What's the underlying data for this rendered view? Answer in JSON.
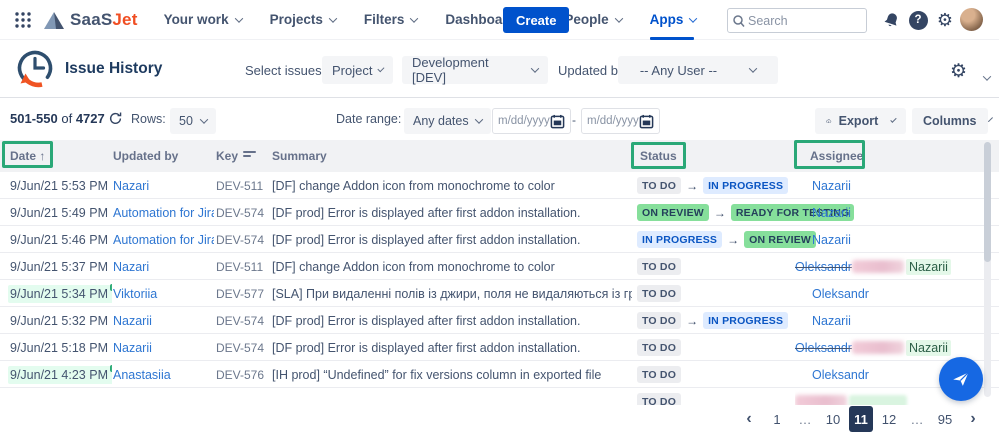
{
  "colors": {
    "brand_blue": "#0052CC",
    "logo_orange": "#F04E23",
    "annotation_green": "#2AA877",
    "badge_green_bg": "#86DF9B",
    "badge_blue_bg": "#DEEBFF",
    "selected_page_bg": "#253858",
    "fab_blue": "#1668E3"
  },
  "nav": {
    "logo_saas": "SaaS",
    "logo_jet": "Jet",
    "items": [
      {
        "label": "Your work",
        "active": false
      },
      {
        "label": "Projects",
        "active": false
      },
      {
        "label": "Filters",
        "active": false
      },
      {
        "label": "Dashboards",
        "active": false
      },
      {
        "label": "People",
        "active": false
      },
      {
        "label": "Apps",
        "active": true
      }
    ],
    "create_label": "Create",
    "search_placeholder": "Search",
    "help_glyph": "?",
    "gear_glyph": "⚙"
  },
  "header": {
    "title": "Issue History",
    "select_issues_label": "Select issues by:",
    "select_mode_value": "Project",
    "project_value": "Development [DEV]",
    "updated_by_label": "Updated by:",
    "updated_by_value": "-- Any User --",
    "gear_glyph": "⚙"
  },
  "toolbar": {
    "range": "501-550",
    "of_label": "of",
    "total": "4727",
    "rows_label": "Rows:",
    "rows_value": "50",
    "date_range_label": "Date range:",
    "date_range_value": "Any dates",
    "date_from_placeholder": "m/dd/yyyy",
    "date_to_placeholder": "m/dd/yyyy",
    "separator": "-",
    "export_label": "Export",
    "columns_label": "Columns"
  },
  "table": {
    "sort_arrow": "↑",
    "arrow": "→",
    "headers": {
      "date": "Date",
      "updated_by": "Updated by",
      "key": "Key",
      "summary": "Summary",
      "status": "Status",
      "assignee": "Assignee"
    },
    "rows": [
      {
        "date": "9/Jun/21 5:53 PM",
        "created": false,
        "updated_by": "Nazari",
        "key": "DEV-511",
        "summary": "[DF] change Addon icon from monochrome to color",
        "status": [
          {
            "label": "TO DO",
            "type": "gray"
          },
          {
            "label": "IN PROGRESS",
            "type": "blue"
          }
        ],
        "assignee": {
          "type": "link",
          "name": "Nazarii"
        }
      },
      {
        "date": "9/Jun/21 5:49 PM",
        "created": false,
        "updated_by": "Automation for Jira",
        "key": "DEV-574",
        "summary": "[DF prod] Error is displayed after first addon installation.",
        "status": [
          {
            "label": "ON REVIEW",
            "type": "green"
          },
          {
            "label": "READY FOR TESTING",
            "type": "green"
          }
        ],
        "assignee": {
          "type": "link",
          "name": "Nazarii"
        }
      },
      {
        "date": "9/Jun/21 5:46 PM",
        "created": false,
        "updated_by": "Automation for Jira",
        "key": "DEV-574",
        "summary": "[DF prod] Error is displayed after first addon installation.",
        "status": [
          {
            "label": "IN PROGRESS",
            "type": "blue"
          },
          {
            "label": "ON REVIEW",
            "type": "green"
          }
        ],
        "assignee": {
          "type": "link",
          "name": "Nazarii"
        }
      },
      {
        "date": "9/Jun/21 5:37 PM",
        "created": false,
        "updated_by": "Nazari",
        "key": "DEV-511",
        "summary": "[DF] change Addon icon from monochrome to color",
        "status": [
          {
            "label": "TO DO",
            "type": "gray"
          }
        ],
        "assignee": {
          "type": "change",
          "old": "Oleksandr",
          "new": "Nazarii"
        }
      },
      {
        "date": "9/Jun/21 5:34 PM",
        "created": true,
        "updated_by": "Viktoriia",
        "key": "DEV-577",
        "summary": "[SLA] При видаленні полів із джири, поля не видаляються із гріда",
        "status": [
          {
            "label": "TO DO",
            "type": "gray"
          }
        ],
        "assignee": {
          "type": "link",
          "name": "Oleksandr"
        }
      },
      {
        "date": "9/Jun/21 5:32 PM",
        "created": false,
        "updated_by": "Nazarii",
        "key": "DEV-574",
        "summary": "[DF prod] Error is displayed after first addon installation.",
        "status": [
          {
            "label": "TO DO",
            "type": "gray"
          },
          {
            "label": "IN PROGRESS",
            "type": "blue"
          }
        ],
        "assignee": {
          "type": "link",
          "name": "Nazarii"
        }
      },
      {
        "date": "9/Jun/21 5:18 PM",
        "created": false,
        "updated_by": "Nazarii",
        "key": "DEV-574",
        "summary": "[DF prod] Error is displayed after first addon installation.",
        "status": [
          {
            "label": "TO DO",
            "type": "gray"
          }
        ],
        "assignee": {
          "type": "change",
          "old": "Oleksandr",
          "new": "Nazarii"
        }
      },
      {
        "date": "9/Jun/21 4:23 PM",
        "created": true,
        "updated_by": "Anastasiia",
        "key": "DEV-576",
        "summary": "[IH prod] “Undefined” for fix versions column in exported file",
        "status": [
          {
            "label": "TO DO",
            "type": "gray"
          }
        ],
        "assignee": {
          "type": "link",
          "name": "Oleksandr"
        }
      },
      {
        "date": "",
        "created": false,
        "updated_by": "",
        "key": "",
        "summary": "",
        "status": [
          {
            "label": "TO DO",
            "type": "gray"
          }
        ],
        "assignee": {
          "type": "smudge"
        }
      }
    ]
  },
  "pagination": {
    "items": [
      {
        "label": "‹",
        "type": "prev"
      },
      {
        "label": "1",
        "type": "page"
      },
      {
        "label": "…",
        "type": "ellipsis"
      },
      {
        "label": "10",
        "type": "page"
      },
      {
        "label": "11",
        "type": "page",
        "current": true
      },
      {
        "label": "12",
        "type": "page"
      },
      {
        "label": "…",
        "type": "ellipsis"
      },
      {
        "label": "95",
        "type": "page"
      },
      {
        "label": "›",
        "type": "next"
      }
    ]
  },
  "annotations": {
    "highlighted_columns": [
      "Date",
      "Status",
      "Assignee"
    ],
    "color": "#2AA877"
  }
}
